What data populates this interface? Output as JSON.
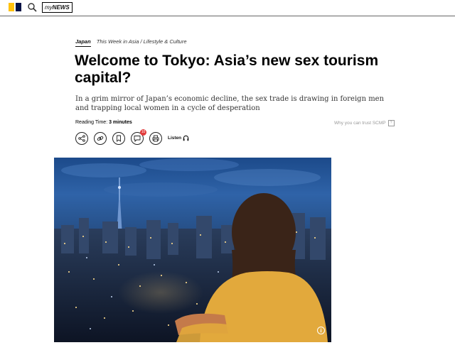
{
  "header": {
    "brand_colors": {
      "yellow": "#ffc20e",
      "navy": "#001246"
    },
    "search_icon": "search-icon",
    "mynews_my": "my",
    "mynews_news": "NEWS"
  },
  "article": {
    "section": "Japan",
    "topics": "This Week in Asia / Lifestyle & Culture",
    "headline": "Welcome to Tokyo: Asia’s new sex tourism capital?",
    "summary": "In a grim mirror of Japan’s economic decline, the sex trade is drawing in foreign men and trapping local women in a cycle of desperation",
    "reading_label": "Reading Time: ",
    "reading_value": "3 minutes",
    "trust_text": "Why you can trust SCMP",
    "comment_count": "10",
    "listen_label": "Listen"
  },
  "hero": {
    "description_icon": "info-icon"
  }
}
